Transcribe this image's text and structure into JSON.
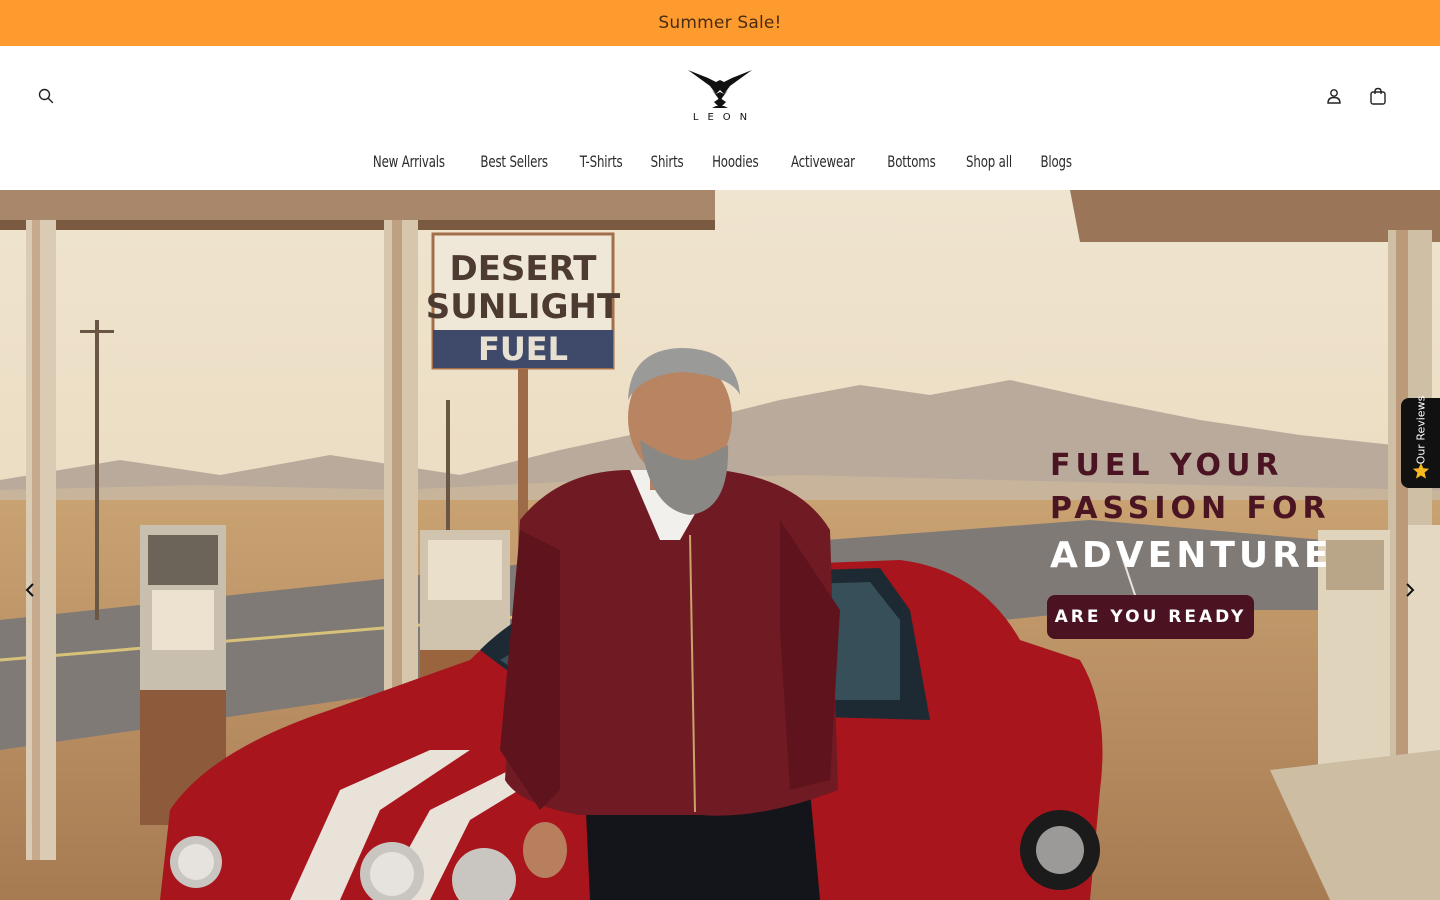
{
  "announcement": {
    "text": "Summer Sale!"
  },
  "header": {
    "logo_text": "LEON",
    "icons": {
      "search": "search-icon",
      "account": "user-icon",
      "cart": "bag-icon"
    }
  },
  "nav": {
    "items": [
      {
        "label": "New Arrivals"
      },
      {
        "label": "Best Sellers"
      },
      {
        "label": "T-Shirts"
      },
      {
        "label": "Shirts"
      },
      {
        "label": "Hoodies"
      },
      {
        "label": "Activewear"
      },
      {
        "label": "Bottoms"
      },
      {
        "label": "Shop all"
      },
      {
        "label": "Blogs"
      }
    ]
  },
  "hero": {
    "headline_line1": "FUEL YOUR",
    "headline_line2": "PASSION FOR",
    "headline_line3": "ADVENTURE",
    "cta_label": "ARE YOU READY",
    "sign_line1": "DESERT",
    "sign_line2": "SUNLIGHT",
    "sign_line3": "FUEL"
  },
  "reviews_tab": {
    "label": "Our Reviews"
  },
  "colors": {
    "announcement_bg": "#fd9b2e",
    "headline_dark": "#4a1422",
    "cta_bg": "#4b1322"
  }
}
